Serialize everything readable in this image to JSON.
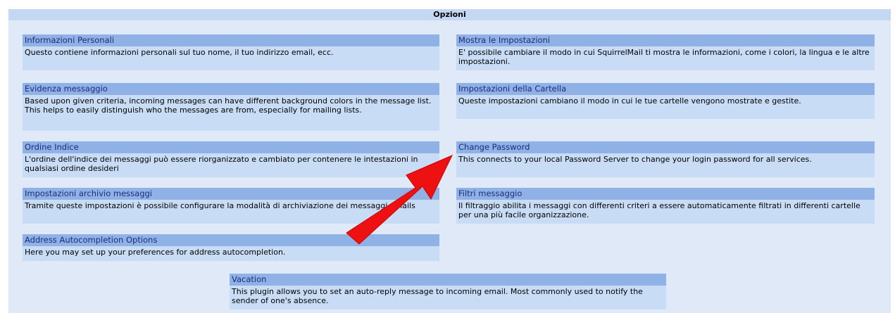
{
  "header": {
    "title": "Opzioni"
  },
  "options": {
    "personal": {
      "title": "Informazioni Personali",
      "desc": "Questo contiene informazioni personali sul tuo nome, il tuo indirizzo email, ecc."
    },
    "display": {
      "title": "Mostra le Impostazioni",
      "desc": "E' possibile cambiare il modo in cui SquirrelMail ti mostra le informazioni, come i colori, la lingua e le altre impostazioni."
    },
    "highlight": {
      "title": "Evidenza messaggio",
      "desc": "Based upon given criteria, incoming messages can have different background colors in the message list. This helps to easily distinguish who the messages are from, especially for mailing lists."
    },
    "folders": {
      "title": "Impostazioni della Cartella",
      "desc": "Queste impostazioni cambiano il modo in cui le tue cartelle vengono mostrate e gestite."
    },
    "order": {
      "title": "Ordine Indice",
      "desc": "L'ordine dell'indice dei messaggi può essere riorganizzato e cambiato per contenere le intestazioni in qualsiasi ordine desideri"
    },
    "password": {
      "title": "Change Password",
      "desc": "This connects to your local Password Server to change your login password for all services."
    },
    "archive": {
      "title": "Impostazioni archivio messaggi",
      "desc": "Tramite queste impostazioni è possibile configurare la modalità di archiviazione dei messaggi emails"
    },
    "filters": {
      "title": "Filtri messaggio",
      "desc": "Il filtraggio abilita i messaggi con differenti criteri a essere automaticamente filtrati in differenti cartelle per una più facile organizzazione."
    },
    "autocomplete": {
      "title": "Address Autocompletion Options",
      "desc": "Here you may set up your preferences for address autocompletion."
    },
    "vacation": {
      "title": "Vacation",
      "desc": "This plugin allows you to set an auto-reply message to incoming email. Most commonly used to notify the sender of one's absence."
    }
  },
  "colors": {
    "title_bg": "#8fb1e6",
    "desc_bg": "#c9dcf6",
    "panel_bg": "#dfe9f8",
    "arrow": "#ee1111"
  }
}
